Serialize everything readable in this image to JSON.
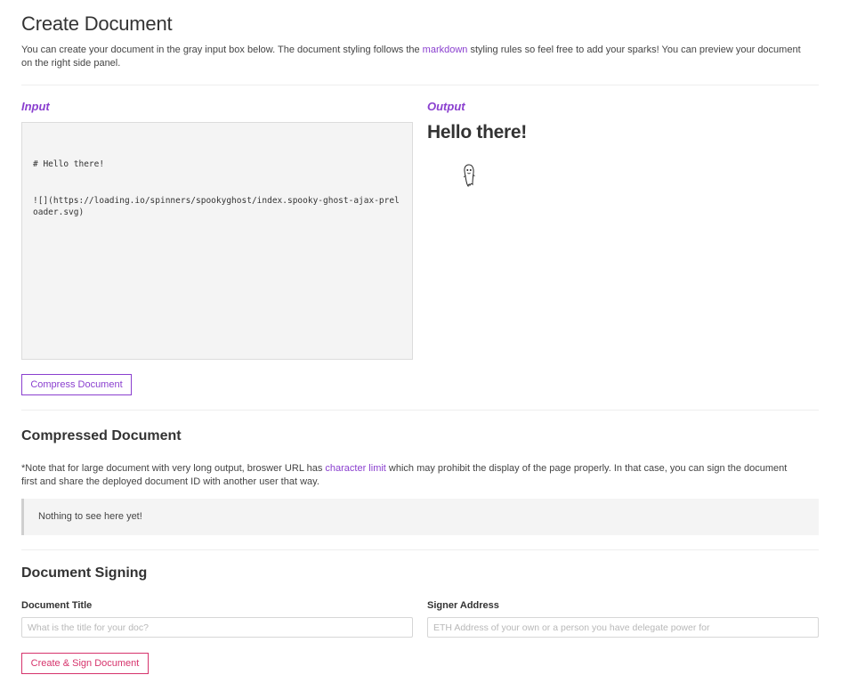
{
  "page": {
    "title": "Create Document",
    "intro_before_link": "You can create your document in the gray input box below. The document styling follows the ",
    "intro_link": "markdown",
    "intro_after_link": " styling rules so feel free to add your sparks! You can preview your document on the right side panel."
  },
  "input_panel": {
    "label": "Input",
    "lines": [
      "# Hello there!",
      "![](https://loading.io/spinners/spookyghost/index.spooky-ghost-ajax-preloader.svg)"
    ]
  },
  "output_panel": {
    "label": "Output",
    "heading": "Hello there!",
    "image_icon": "ghost-icon"
  },
  "compress_button": {
    "label": "Compress Document"
  },
  "compressed": {
    "title": "Compressed Document",
    "note_before_link": "*Note that for large document with very long output, broswer URL has ",
    "note_link": "character limit",
    "note_after_link": " which may prohibit the display of the page properly. In that case, you can sign the document first and share the deployed document ID with another user that way.",
    "empty_text": "Nothing to see here yet!"
  },
  "signing": {
    "title": "Document Signing",
    "doc_title_label": "Document Title",
    "doc_title_value": "",
    "doc_title_placeholder": "What is the title for your doc?",
    "signer_label": "Signer Address",
    "signer_value": "",
    "signer_placeholder": "ETH Address of your own or a person you have delegate power for",
    "submit_label": "Create & Sign Document"
  },
  "colors": {
    "accent": "#8a3fcf",
    "submit": "#d6336c",
    "editor_bg": "#f4f4f4"
  }
}
